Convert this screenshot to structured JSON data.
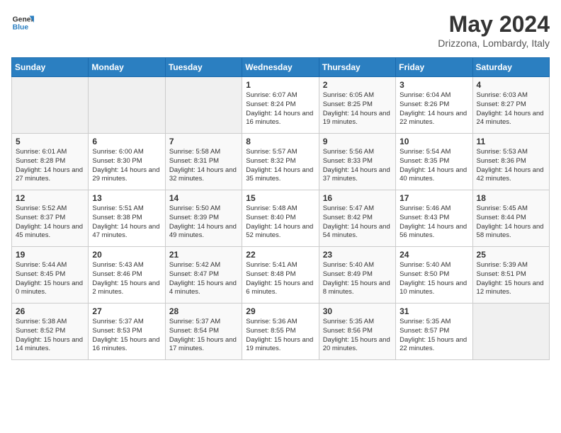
{
  "header": {
    "logo_line1": "General",
    "logo_line2": "Blue",
    "month": "May 2024",
    "location": "Drizzona, Lombardy, Italy"
  },
  "days_of_week": [
    "Sunday",
    "Monday",
    "Tuesday",
    "Wednesday",
    "Thursday",
    "Friday",
    "Saturday"
  ],
  "weeks": [
    [
      {
        "day": "",
        "text": ""
      },
      {
        "day": "",
        "text": ""
      },
      {
        "day": "",
        "text": ""
      },
      {
        "day": "1",
        "text": "Sunrise: 6:07 AM\nSunset: 8:24 PM\nDaylight: 14 hours and 16 minutes."
      },
      {
        "day": "2",
        "text": "Sunrise: 6:05 AM\nSunset: 8:25 PM\nDaylight: 14 hours and 19 minutes."
      },
      {
        "day": "3",
        "text": "Sunrise: 6:04 AM\nSunset: 8:26 PM\nDaylight: 14 hours and 22 minutes."
      },
      {
        "day": "4",
        "text": "Sunrise: 6:03 AM\nSunset: 8:27 PM\nDaylight: 14 hours and 24 minutes."
      }
    ],
    [
      {
        "day": "5",
        "text": "Sunrise: 6:01 AM\nSunset: 8:28 PM\nDaylight: 14 hours and 27 minutes."
      },
      {
        "day": "6",
        "text": "Sunrise: 6:00 AM\nSunset: 8:30 PM\nDaylight: 14 hours and 29 minutes."
      },
      {
        "day": "7",
        "text": "Sunrise: 5:58 AM\nSunset: 8:31 PM\nDaylight: 14 hours and 32 minutes."
      },
      {
        "day": "8",
        "text": "Sunrise: 5:57 AM\nSunset: 8:32 PM\nDaylight: 14 hours and 35 minutes."
      },
      {
        "day": "9",
        "text": "Sunrise: 5:56 AM\nSunset: 8:33 PM\nDaylight: 14 hours and 37 minutes."
      },
      {
        "day": "10",
        "text": "Sunrise: 5:54 AM\nSunset: 8:35 PM\nDaylight: 14 hours and 40 minutes."
      },
      {
        "day": "11",
        "text": "Sunrise: 5:53 AM\nSunset: 8:36 PM\nDaylight: 14 hours and 42 minutes."
      }
    ],
    [
      {
        "day": "12",
        "text": "Sunrise: 5:52 AM\nSunset: 8:37 PM\nDaylight: 14 hours and 45 minutes."
      },
      {
        "day": "13",
        "text": "Sunrise: 5:51 AM\nSunset: 8:38 PM\nDaylight: 14 hours and 47 minutes."
      },
      {
        "day": "14",
        "text": "Sunrise: 5:50 AM\nSunset: 8:39 PM\nDaylight: 14 hours and 49 minutes."
      },
      {
        "day": "15",
        "text": "Sunrise: 5:48 AM\nSunset: 8:40 PM\nDaylight: 14 hours and 52 minutes."
      },
      {
        "day": "16",
        "text": "Sunrise: 5:47 AM\nSunset: 8:42 PM\nDaylight: 14 hours and 54 minutes."
      },
      {
        "day": "17",
        "text": "Sunrise: 5:46 AM\nSunset: 8:43 PM\nDaylight: 14 hours and 56 minutes."
      },
      {
        "day": "18",
        "text": "Sunrise: 5:45 AM\nSunset: 8:44 PM\nDaylight: 14 hours and 58 minutes."
      }
    ],
    [
      {
        "day": "19",
        "text": "Sunrise: 5:44 AM\nSunset: 8:45 PM\nDaylight: 15 hours and 0 minutes."
      },
      {
        "day": "20",
        "text": "Sunrise: 5:43 AM\nSunset: 8:46 PM\nDaylight: 15 hours and 2 minutes."
      },
      {
        "day": "21",
        "text": "Sunrise: 5:42 AM\nSunset: 8:47 PM\nDaylight: 15 hours and 4 minutes."
      },
      {
        "day": "22",
        "text": "Sunrise: 5:41 AM\nSunset: 8:48 PM\nDaylight: 15 hours and 6 minutes."
      },
      {
        "day": "23",
        "text": "Sunrise: 5:40 AM\nSunset: 8:49 PM\nDaylight: 15 hours and 8 minutes."
      },
      {
        "day": "24",
        "text": "Sunrise: 5:40 AM\nSunset: 8:50 PM\nDaylight: 15 hours and 10 minutes."
      },
      {
        "day": "25",
        "text": "Sunrise: 5:39 AM\nSunset: 8:51 PM\nDaylight: 15 hours and 12 minutes."
      }
    ],
    [
      {
        "day": "26",
        "text": "Sunrise: 5:38 AM\nSunset: 8:52 PM\nDaylight: 15 hours and 14 minutes."
      },
      {
        "day": "27",
        "text": "Sunrise: 5:37 AM\nSunset: 8:53 PM\nDaylight: 15 hours and 16 minutes."
      },
      {
        "day": "28",
        "text": "Sunrise: 5:37 AM\nSunset: 8:54 PM\nDaylight: 15 hours and 17 minutes."
      },
      {
        "day": "29",
        "text": "Sunrise: 5:36 AM\nSunset: 8:55 PM\nDaylight: 15 hours and 19 minutes."
      },
      {
        "day": "30",
        "text": "Sunrise: 5:35 AM\nSunset: 8:56 PM\nDaylight: 15 hours and 20 minutes."
      },
      {
        "day": "31",
        "text": "Sunrise: 5:35 AM\nSunset: 8:57 PM\nDaylight: 15 hours and 22 minutes."
      },
      {
        "day": "",
        "text": ""
      }
    ]
  ]
}
